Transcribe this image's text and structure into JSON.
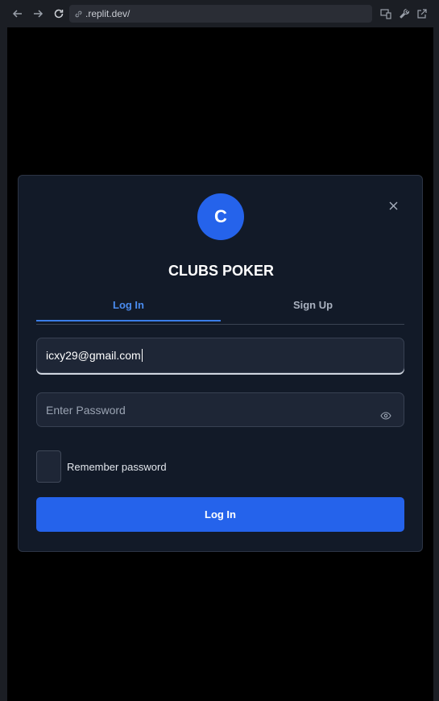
{
  "browser": {
    "url": ".replit.dev/"
  },
  "modal": {
    "logo_letter": "C",
    "title": "CLUBS POKER",
    "tabs": [
      {
        "label": "Log In",
        "active": true
      },
      {
        "label": "Sign Up",
        "active": false
      }
    ],
    "email_value": "icxy29@gmail.com",
    "password_placeholder": "Enter Password",
    "remember_label": "Remember password",
    "submit_label": "Log In"
  },
  "colors": {
    "accent": "#2563eb",
    "modal_bg": "#121a28",
    "field_bg": "#1e2636",
    "active_tab": "#4a8cf0"
  }
}
